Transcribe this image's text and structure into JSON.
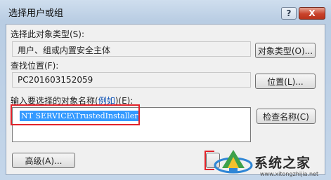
{
  "window": {
    "title": "选择用户或组",
    "help_label": "?",
    "close_label": "X"
  },
  "object_type": {
    "label": "选择此对象类型(S):",
    "value": "用户、组或内置安全主体",
    "button": "对象类型(O)..."
  },
  "location": {
    "label": "查找位置(F):",
    "value": "PC201603152059",
    "button": "位置(L)..."
  },
  "names": {
    "label_prefix": "输入要选择的对象名称(",
    "label_link": "例如",
    "label_suffix": ")(E):",
    "value": "NT SERVICE\\TrustedInstaller",
    "check_button": "检查名称(C)"
  },
  "footer": {
    "advanced_button": "高级(A)..."
  },
  "watermark": {
    "brand": "系统之家",
    "url": "www.xitongzhijia.net"
  },
  "colors": {
    "highlight_box": "#e2232a",
    "selection": "#3399ff",
    "link": "#0a4fb4"
  }
}
